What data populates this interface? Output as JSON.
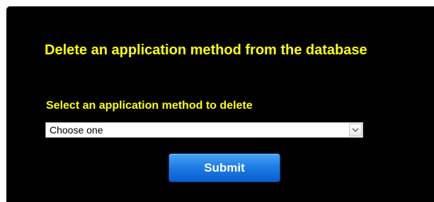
{
  "form": {
    "heading": "Delete an application method from the database",
    "select_label": "Select an application method to delete",
    "select": {
      "selected_value": "Choose one",
      "arrow_icon": "chevron-down-icon"
    },
    "submit_label": "Submit"
  },
  "colors": {
    "panel_background": "#000000",
    "label_text": "#ffff00",
    "button_blue": "#1f7fe6",
    "button_text": "#ffffff"
  }
}
